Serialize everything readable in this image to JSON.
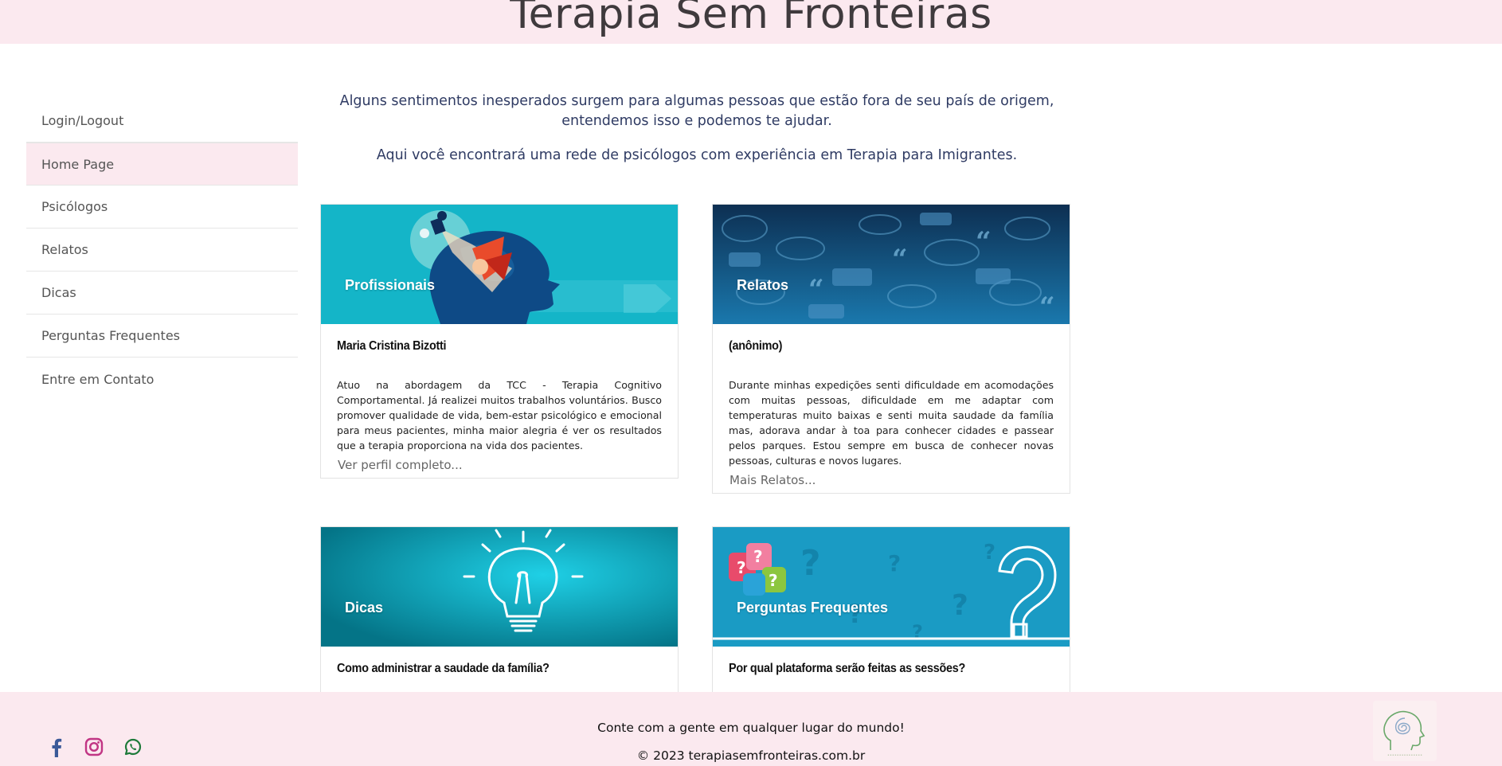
{
  "header": {
    "title": "Terapia Sem Fronteiras"
  },
  "sidebar": {
    "items": [
      {
        "label": "Login/Logout"
      },
      {
        "label": "Home Page"
      },
      {
        "label": "Psicólogos"
      },
      {
        "label": "Relatos"
      },
      {
        "label": "Dicas"
      },
      {
        "label": "Perguntas Frequentes"
      },
      {
        "label": "Entre em Contato"
      }
    ],
    "active": "Home Page"
  },
  "intro": {
    "line1": "Alguns sentimentos inesperados surgem para algumas pessoas que estão fora de seu país de origem, entendemos isso e podemos te ajudar.",
    "line2": "Aqui você encontrará uma rede de psicólogos com experiência em Terapia para Imigrantes."
  },
  "cards": [
    {
      "tag": "Profissionais",
      "title": "Maria Cristina Bizotti",
      "text": "Atuo na abordagem da TCC - Terapia Cognitivo Comportamental. Já realizei muitos trabalhos voluntários. Busco promover qualidade de vida, bem-estar psicológico e emocional para meus pacientes, minha maior alegria é ver os resultados que a terapia proporciona na vida dos pacientes.",
      "link": "Ver perfil completo..."
    },
    {
      "tag": "Relatos",
      "title": "(anônimo)",
      "text": "Durante minhas expedições senti dificuldade em acomodações com muitas pessoas, dificuldade em me adaptar com temperaturas muito baixas e senti muita saudade da família mas, adorava andar à toa para conhecer cidades e passear pelos parques. Estou sempre em busca de conhecer novas pessoas, culturas e novos lugares.",
      "link": "Mais Relatos..."
    },
    {
      "tag": "Dicas",
      "title": "Como administrar a saudade da família?"
    },
    {
      "tag": "Perguntas Frequentes",
      "title": "Por qual plataforma serão feitas as sessões?"
    }
  ],
  "footer": {
    "tagline": "Conte com a gente em qualquer lugar do mundo!",
    "copyright": "© 2023 terapiasemfronteiras.com.br",
    "social": [
      "facebook-icon",
      "instagram-icon",
      "whatsapp-icon"
    ]
  },
  "colors": {
    "pink_bg": "#fbe9ef",
    "intro_text": "#2f3b63",
    "facebook": "#3b5998",
    "instagram": "#c13584",
    "whatsapp": "#1e7a3a"
  }
}
